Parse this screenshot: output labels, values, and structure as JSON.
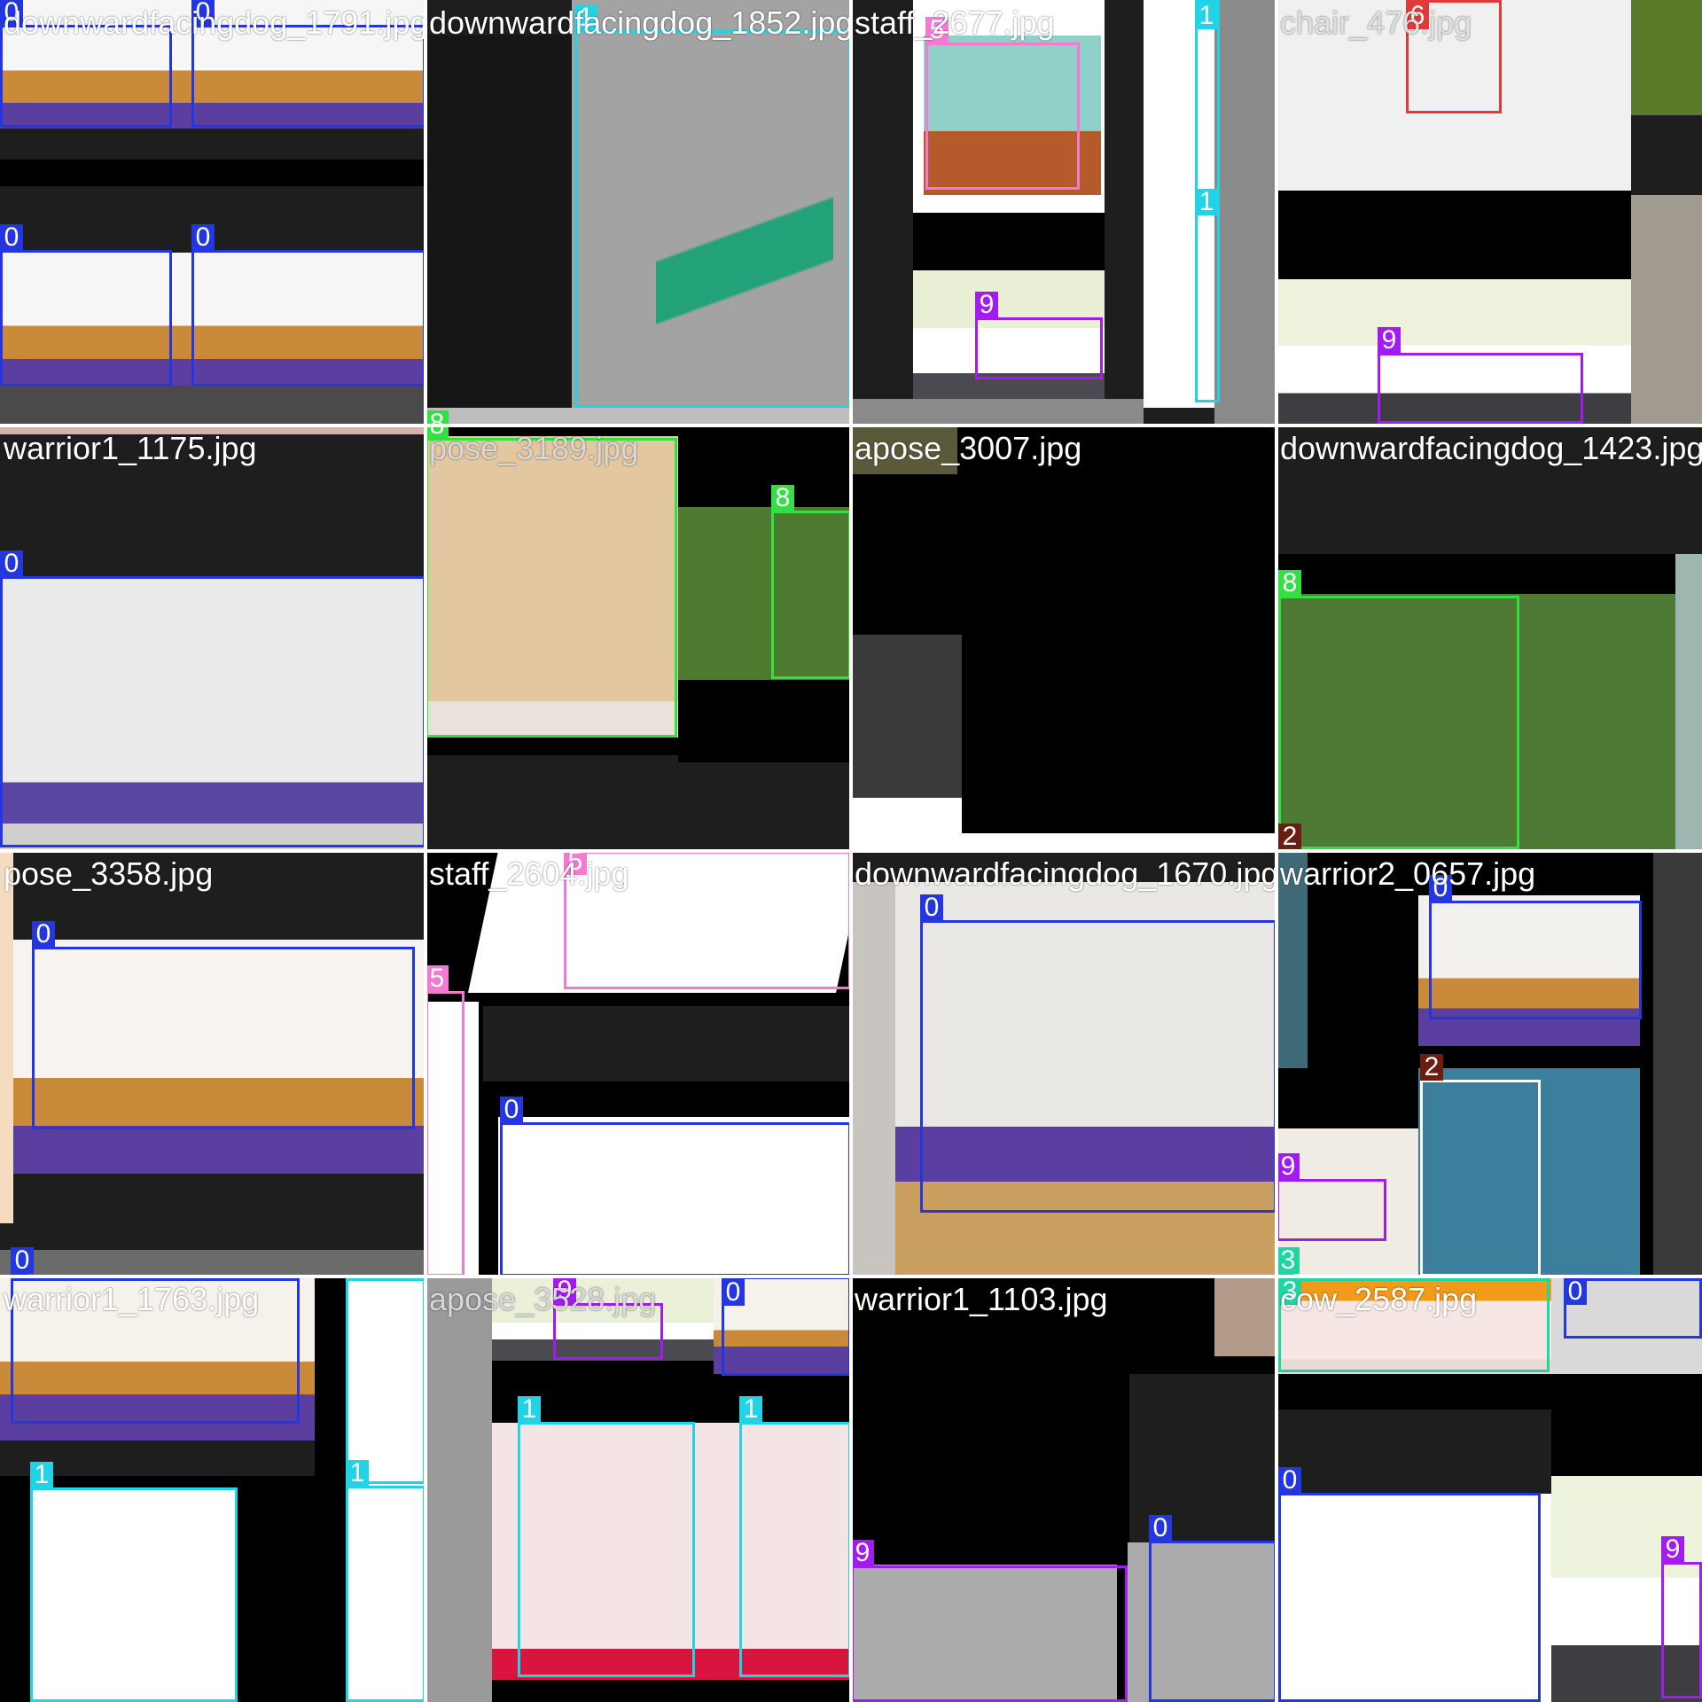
{
  "class_colors": {
    "0": "#2336e0",
    "1": "#22d3e6",
    "2": "#6b1d12",
    "3": "#1fd6a0",
    "5": "#f37ad3",
    "6": "#e23a3a",
    "8": "#33e044",
    "9": "#a21bf0"
  },
  "tiles": [
    {
      "filename": "downwardfacingdog_1791.jpg",
      "boxes": [
        {
          "label": "0"
        },
        {
          "label": "0"
        },
        {
          "label": "0"
        },
        {
          "label": "0"
        }
      ]
    },
    {
      "filename": "downwardfacingdog_1852.jpg",
      "boxes": [
        {
          "label": "1"
        },
        {
          "label": "8"
        }
      ]
    },
    {
      "filename": "staff_2677.jpg",
      "boxes": [
        {
          "label": "5"
        },
        {
          "label": "9"
        },
        {
          "label": "1"
        },
        {
          "label": "1"
        }
      ]
    },
    {
      "filename": "chair_476.jpg",
      "boxes": [
        {
          "label": "6"
        },
        {
          "label": "9"
        }
      ]
    },
    {
      "filename": "warrior1_1175.jpg",
      "boxes": [
        {
          "label": "0"
        }
      ]
    },
    {
      "filename": "pose_3189.jpg",
      "boxes": [
        {
          "label": "8"
        },
        {
          "label": "8"
        }
      ]
    },
    {
      "filename": "apose_3007.jpg",
      "boxes": []
    },
    {
      "filename": "downwardfacingdog_1423.jpg",
      "boxes": [
        {
          "label": "8"
        },
        {
          "label": "2"
        }
      ]
    },
    {
      "filename": "pose_3358.jpg",
      "boxes": [
        {
          "label": "0"
        },
        {
          "label": "0"
        }
      ]
    },
    {
      "filename": "staff_2604.jpg",
      "boxes": [
        {
          "label": "5"
        },
        {
          "label": "5"
        },
        {
          "label": "0"
        }
      ]
    },
    {
      "filename": "downwardfacingdog_1670.jpg",
      "boxes": [
        {
          "label": "0"
        }
      ]
    },
    {
      "filename": "warrior2_0657.jpg",
      "boxes": [
        {
          "label": "0"
        },
        {
          "label": "2"
        },
        {
          "label": "9"
        },
        {
          "label": "3"
        }
      ]
    },
    {
      "filename": "warrior1_1763.jpg",
      "boxes": [
        {
          "label": "0"
        },
        {
          "label": "1"
        },
        {
          "label": "1"
        },
        {
          "label": "1"
        }
      ]
    },
    {
      "filename": "apose_3528.jpg",
      "boxes": [
        {
          "label": "9"
        },
        {
          "label": "0"
        },
        {
          "label": "1"
        },
        {
          "label": "1"
        }
      ]
    },
    {
      "filename": "warrior1_1103.jpg",
      "boxes": [
        {
          "label": "9"
        },
        {
          "label": "0"
        }
      ]
    },
    {
      "filename": "cow_2587.jpg",
      "boxes": [
        {
          "label": "3"
        },
        {
          "label": "0"
        },
        {
          "label": "0"
        },
        {
          "label": "9"
        }
      ]
    }
  ]
}
